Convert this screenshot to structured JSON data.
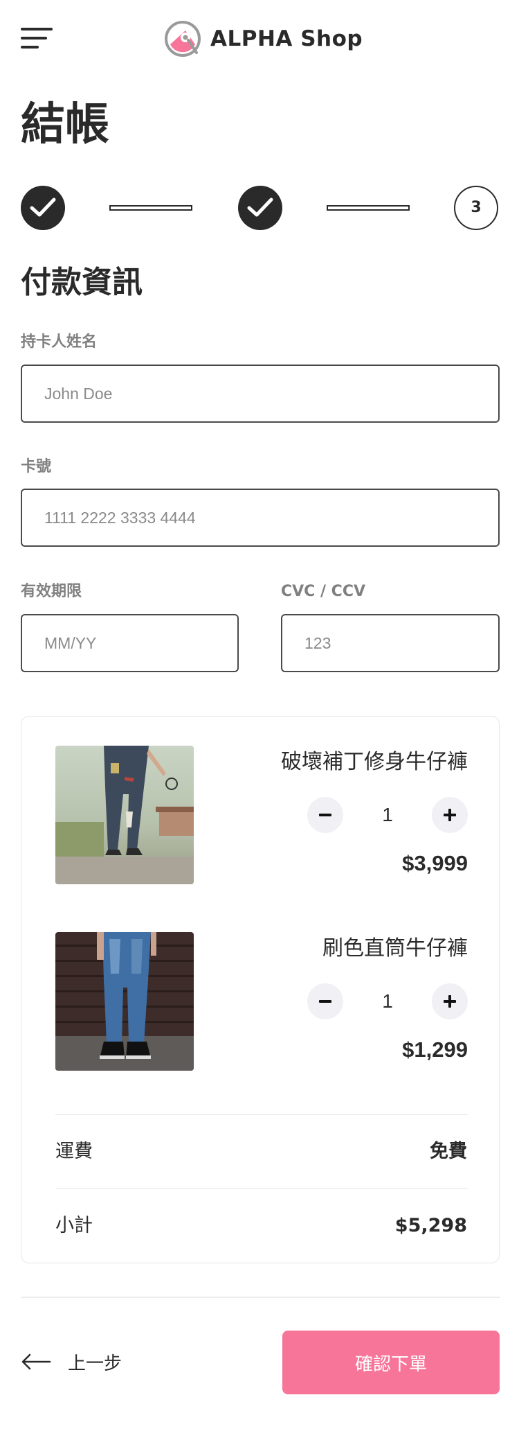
{
  "header": {
    "brand_name": "ALPHA Shop",
    "menu_icon": "hamburger-menu-icon",
    "logo_icon": "alpha-logo-icon",
    "brand_color": "#f67599"
  },
  "page_title": "結帳",
  "stepper": {
    "steps": [
      {
        "state": "done",
        "icon": "check-icon"
      },
      {
        "state": "done",
        "icon": "check-icon"
      },
      {
        "state": "current",
        "number": "3"
      }
    ]
  },
  "payment": {
    "section_title": "付款資訊",
    "cardholder": {
      "label": "持卡人姓名",
      "placeholder": "John Doe",
      "value": ""
    },
    "card_number": {
      "label": "卡號",
      "placeholder": "1111 2222 3333 4444",
      "value": ""
    },
    "expiry": {
      "label": "有效期限",
      "placeholder": "MM/YY",
      "value": ""
    },
    "cvc": {
      "label": "CVC / CCV",
      "placeholder": "123",
      "value": ""
    }
  },
  "cart": {
    "items": [
      {
        "name": "破壞補丁修身牛仔褲",
        "quantity": "1",
        "price": "$3,999"
      },
      {
        "name": "刷色直筒牛仔褲",
        "quantity": "1",
        "price": "$1,299"
      }
    ],
    "shipping": {
      "label": "運費",
      "value": "免費"
    },
    "subtotal": {
      "label": "小計",
      "value": "$5,298"
    }
  },
  "footer": {
    "back_label": "上一步",
    "back_icon": "arrow-left-icon",
    "confirm_label": "確認下單",
    "confirm_color": "#f67599"
  }
}
